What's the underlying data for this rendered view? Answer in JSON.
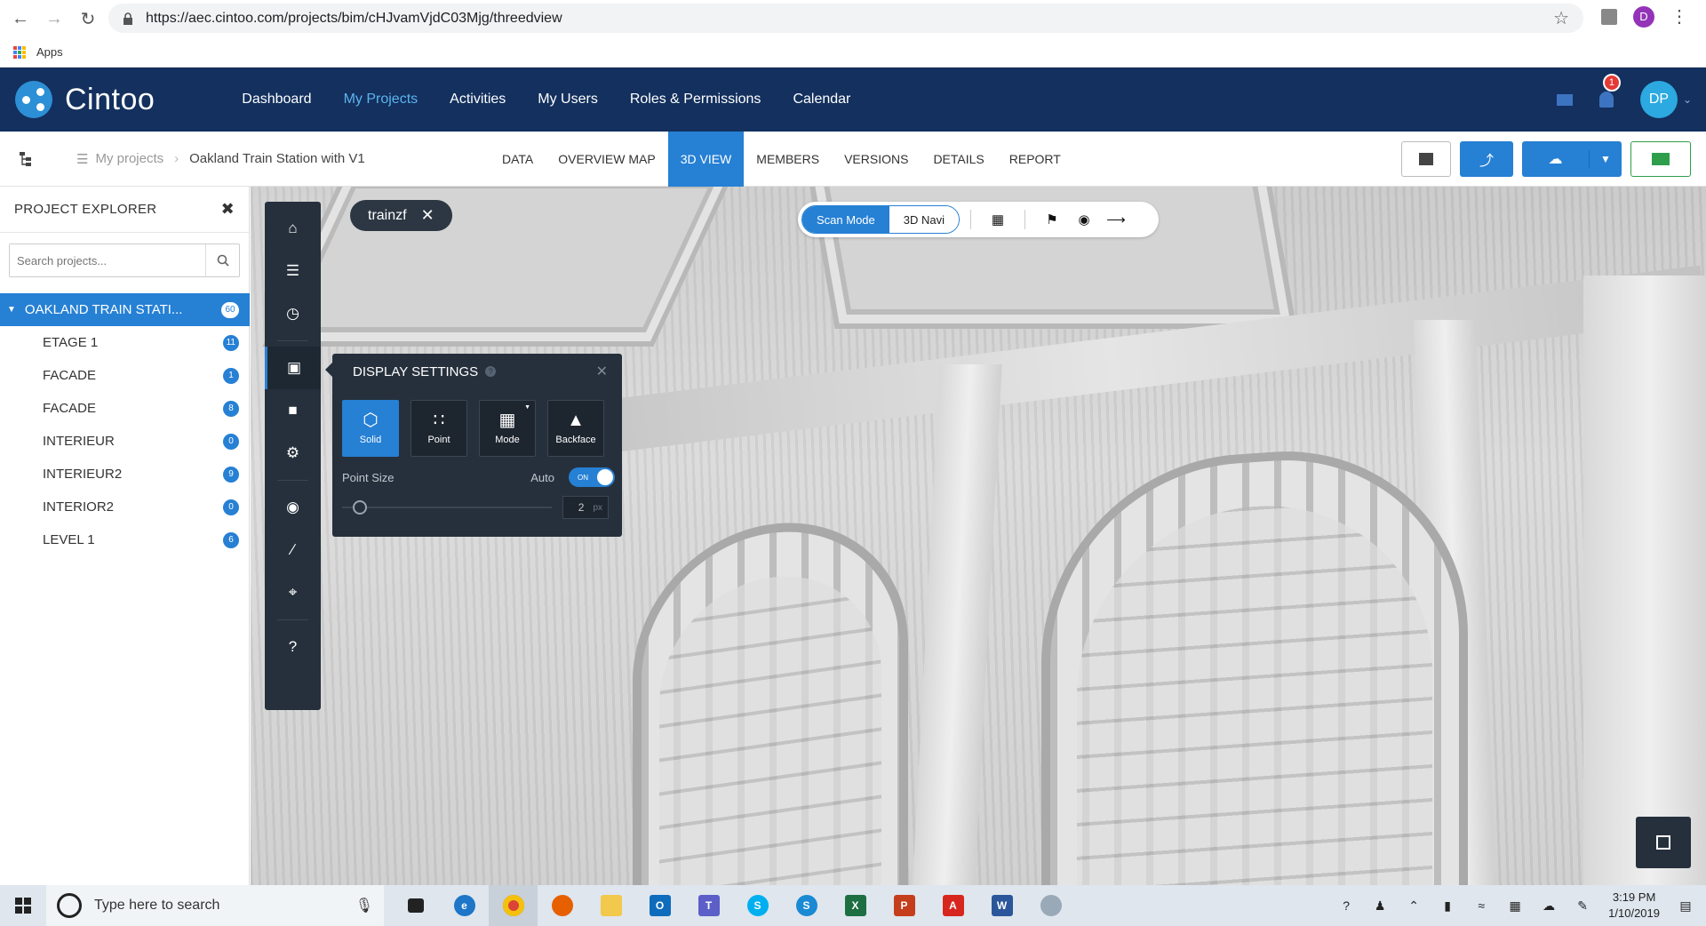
{
  "browser": {
    "url": "https://aec.cintoo.com/projects/bim/cHJvamVjdC03Mjg/threedview",
    "bookmark_apps": "Apps",
    "profile_initial": "D"
  },
  "header": {
    "logo_text": "Cintoo",
    "nav": [
      "Dashboard",
      "My Projects",
      "Activities",
      "My Users",
      "Roles & Permissions",
      "Calendar"
    ],
    "notifications_count": "1",
    "user_initials": "DP"
  },
  "subheader": {
    "breadcrumb_root": "My projects",
    "breadcrumb_current": "Oakland Train Station with V1",
    "tabs": [
      "DATA",
      "OVERVIEW MAP",
      "3D VIEW",
      "MEMBERS",
      "VERSIONS",
      "DETAILS",
      "REPORT"
    ],
    "active_tab": "3D VIEW"
  },
  "explorer": {
    "title": "PROJECT EXPLORER",
    "search_placeholder": "Search projects...",
    "root": {
      "label": "OAKLAND TRAIN STATI...",
      "count": "60"
    },
    "items": [
      {
        "label": "ETAGE 1",
        "count": "11"
      },
      {
        "label": "FACADE",
        "count": "1"
      },
      {
        "label": "FACADE",
        "count": "8"
      },
      {
        "label": "INTERIEUR",
        "count": "0"
      },
      {
        "label": "INTERIEUR2",
        "count": "9"
      },
      {
        "label": "INTERIOR2",
        "count": "0"
      },
      {
        "label": "LEVEL 1",
        "count": "6"
      }
    ]
  },
  "viewer": {
    "tag": "trainzf",
    "scan_mode_label": "Scan Mode",
    "nav_mode_label": "3D Navi",
    "display_settings": {
      "title": "DISPLAY SETTINGS",
      "tools": [
        "Solid",
        "Point",
        "Mode",
        "Backface"
      ],
      "point_size_label": "Point Size",
      "auto_label": "Auto",
      "toggle_text": "ON",
      "point_size_value": "2",
      "point_size_unit": "px"
    }
  },
  "taskbar": {
    "search_placeholder": "Type here to search",
    "time": "3:19 PM",
    "date": "1/10/2019"
  },
  "colors": {
    "header_bg": "#13305e",
    "accent": "#2680d4",
    "nav_active": "#5db3f0",
    "toolbar_dark": "#25303c"
  }
}
